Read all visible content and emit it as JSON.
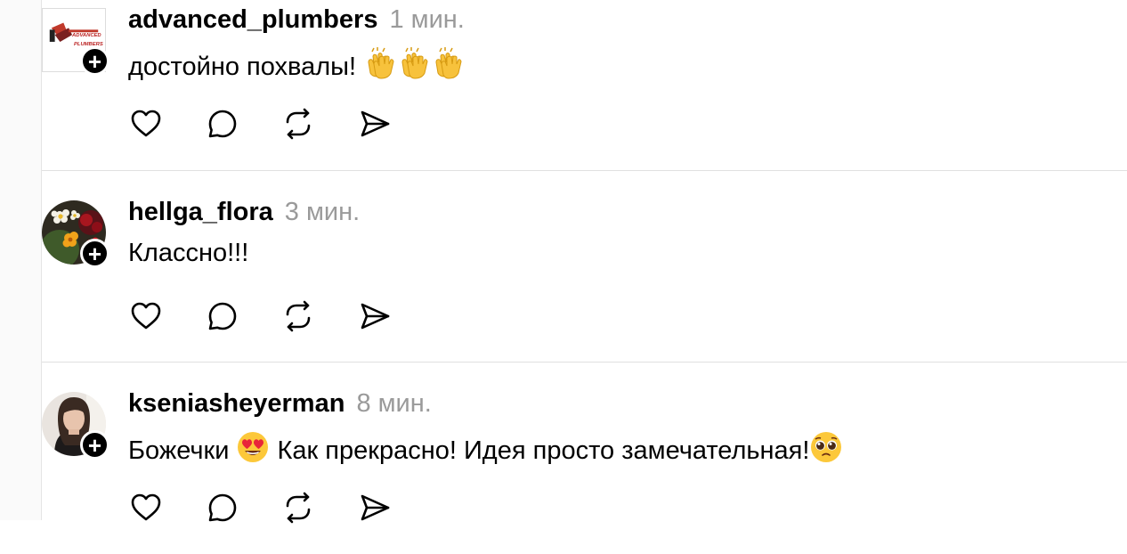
{
  "comments": [
    {
      "username": "advanced_plumbers",
      "time": "1 мин.",
      "text": "достойно похвалы!",
      "text_emojis": [
        "clapping-hands",
        "clapping-hands",
        "clapping-hands"
      ],
      "avatar_style": "square-logo",
      "avatar_logo_text": "ADVANCED PLUMBERS"
    },
    {
      "username": "hellga_flora",
      "time": "3 мин.",
      "text": "Классно!!!",
      "avatar_style": "round-flowers"
    },
    {
      "username": "kseniasheyerman",
      "time": "8 мин.",
      "text_before": "Божечки",
      "text_after": "Как прекрасно! Идея просто замечательная!",
      "text_emojis": [
        "heart-eyes-face",
        "pleading-face"
      ],
      "avatar_style": "round-photo"
    }
  ],
  "actions": [
    "like-icon",
    "comment-icon",
    "repost-icon",
    "share-icon"
  ],
  "follow_badge_symbol": "+",
  "colors": {
    "text": "#000000",
    "muted": "#9a9a9a",
    "divider": "#e0e0e0",
    "badge": "#000000"
  }
}
